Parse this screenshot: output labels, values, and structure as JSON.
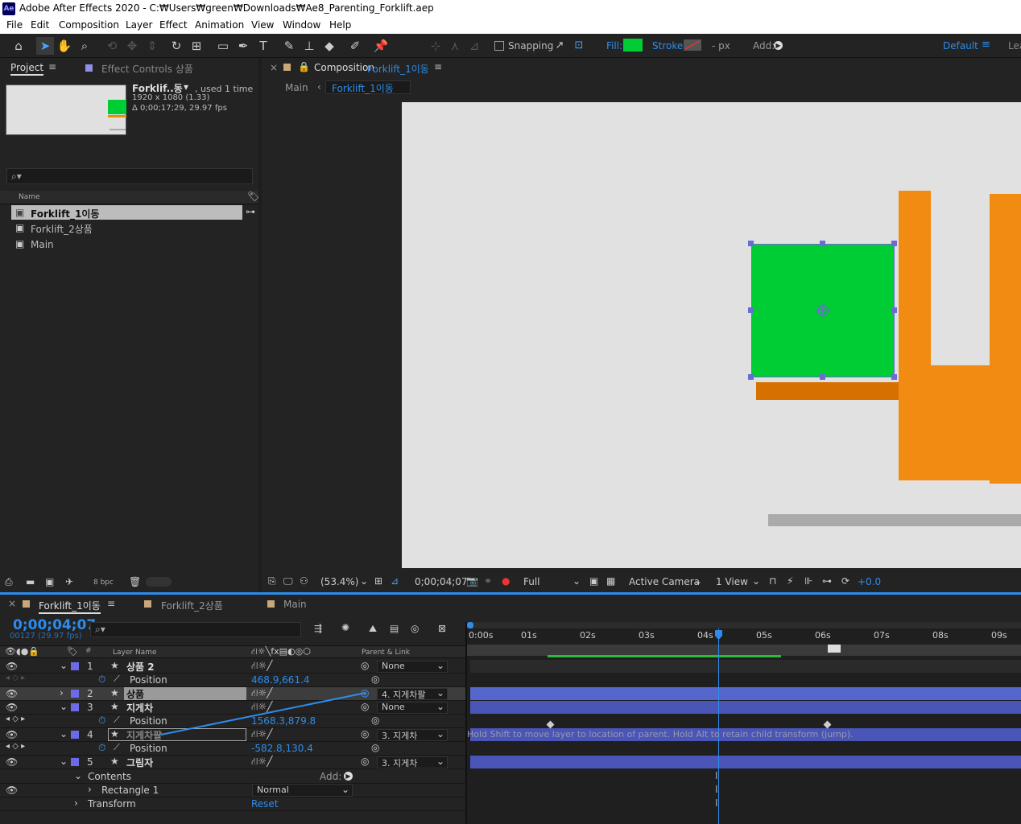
{
  "window": {
    "app_icon": "Ae",
    "title": "Adobe After Effects 2020 - C:₩Users₩green₩Downloads₩Ae8_Parenting_Forklift.aep"
  },
  "menu": [
    "File",
    "Edit",
    "Composition",
    "Layer",
    "Effect",
    "Animation",
    "View",
    "Window",
    "Help"
  ],
  "toolbar": {
    "snapping": "Snapping",
    "fill": "Fill:",
    "stroke": "Stroke:",
    "stroke_px": "- px",
    "add": "Add:",
    "workspace": "Default",
    "workspace_next": "Lea",
    "fill_color": "#00cc33",
    "accent": "#2d8ceb"
  },
  "project": {
    "tab_project": "Project",
    "tab_effect": "Effect Controls 상품",
    "comp_name": "Forklif..동",
    "used": ", used 1 time",
    "resolution": "1920 x 1080 (1.33)",
    "duration": "Δ 0;00;17;29, 29.97 fps",
    "search_placeholder": "",
    "col_name": "Name",
    "items": [
      "Forklift_1이동",
      "Forklift_2상품",
      "Main"
    ],
    "bpc": "8 bpc"
  },
  "composition": {
    "tab_prefix": "Composition",
    "tab_name": "Forklift_1이동",
    "crumb_main": "Main",
    "crumb_current": "Forklift_1이동",
    "zoom": "(53.4%)",
    "timecode": "0;00;04;07",
    "resolution": "Full",
    "camera": "Active Camera",
    "view": "1 View",
    "exposure": "+0.0"
  },
  "timeline": {
    "tabs": [
      "Forklift_1이동",
      "Forklift_2상품",
      "Main"
    ],
    "timecode": "0;00;04;07",
    "frame_info": "00127 (29.97 fps)",
    "col_layer_name": "Layer Name",
    "col_parent": "Parent & Link",
    "ruler": [
      "0:00s",
      "01s",
      "02s",
      "03s",
      "04s",
      "05s",
      "06s",
      "07s",
      "08s",
      "09s"
    ],
    "layers": [
      {
        "num": "1",
        "name": "상품 2",
        "parent": "None"
      },
      {
        "num": "2",
        "name": "상품",
        "parent": "4. 지게차팔"
      },
      {
        "num": "3",
        "name": "지게차",
        "parent": "None"
      },
      {
        "num": "4",
        "name": "지게차팔",
        "parent": "3. 지게차"
      },
      {
        "num": "5",
        "name": "그림자",
        "parent": "3. 지게차"
      }
    ],
    "position_label": "Position",
    "pos1": "468.9,661.4",
    "pos3": "1568.3,879.8",
    "pos4": "-582.8,130.4",
    "contents": "Contents",
    "add": "Add:",
    "rectangle": "Rectangle 1",
    "blend": "Normal",
    "transform": "Transform",
    "reset": "Reset",
    "hint": "Hold Shift to move layer to location of parent. Hold Alt to retain child transform (jump).",
    "playhead_seconds": 4.23
  }
}
